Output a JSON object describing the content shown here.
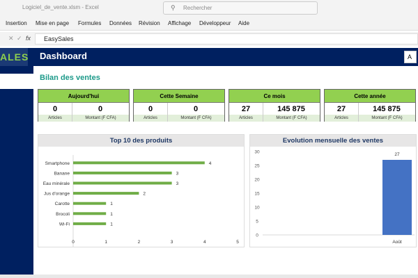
{
  "window": {
    "title": "Logiciel_de_vente.xlsm - Excel",
    "search_placeholder": "Rechercher"
  },
  "ribbon": {
    "tabs": [
      "Insertion",
      "Mise en page",
      "Formules",
      "Données",
      "Révision",
      "Affichage",
      "Développeur",
      "Aide"
    ]
  },
  "formula_bar": {
    "value": "EasySales",
    "fx": "fx"
  },
  "app": {
    "logo": "ALES",
    "title": "Dashboard",
    "header_button": "A"
  },
  "section_title": "Bilan des ventes",
  "cards": [
    {
      "title": "Aujourd'hui",
      "articles": "0",
      "montant": "0",
      "articles_label": "Articles",
      "montant_label": "Montant (F CFA)"
    },
    {
      "title": "Cette Semaine",
      "articles": "0",
      "montant": "0",
      "articles_label": "Articles",
      "montant_label": "Montant (F CFA)"
    },
    {
      "title": "Ce mois",
      "articles": "27",
      "montant": "145 875",
      "articles_label": "Articles",
      "montant_label": "Montant (F CFA)"
    },
    {
      "title": "Cette année",
      "articles": "27",
      "montant": "145 875",
      "articles_label": "Articles",
      "montant_label": "Montant (F CFA)"
    }
  ],
  "chart_data": [
    {
      "type": "bar",
      "orientation": "horizontal",
      "title": "Top 10 des produits",
      "categories": [
        "Smartphone",
        "Banane",
        "Eau minérale",
        "Jus d'orange",
        "Carotte",
        "Brocoli",
        "Wi-Fi"
      ],
      "values": [
        4,
        3,
        3,
        2,
        1,
        1,
        1
      ],
      "xlim": [
        0,
        5
      ],
      "xticks": [
        "0",
        "1",
        "2",
        "3",
        "4",
        "5"
      ],
      "color": "#70ad47"
    },
    {
      "type": "bar",
      "title": "Evolution mensuelle des ventes",
      "categories": [
        "Août"
      ],
      "values": [
        27
      ],
      "ylim": [
        0,
        30
      ],
      "yticks": [
        "0",
        "5",
        "10",
        "15",
        "20",
        "25",
        "30"
      ],
      "color": "#4472c4"
    }
  ]
}
